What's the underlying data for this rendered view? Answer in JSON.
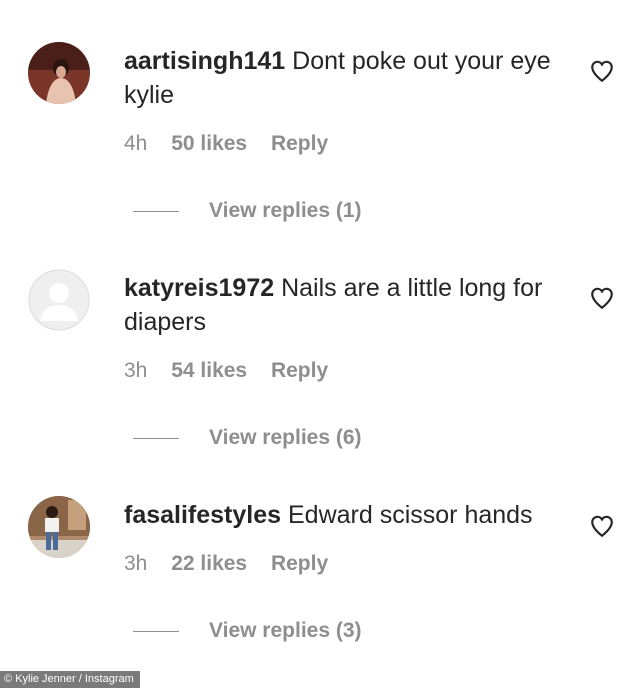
{
  "comments": [
    {
      "username": "aartisingh141",
      "text": "Dont poke out your eye kylie",
      "time": "4h",
      "likes": "50 likes",
      "reply_label": "Reply",
      "view_replies": "View replies (1)",
      "avatar_icon": "user-photo-avatar"
    },
    {
      "username": "katyreis1972",
      "text": "Nails are a little long for diapers",
      "time": "3h",
      "likes": "54 likes",
      "reply_label": "Reply",
      "view_replies": "View replies (6)",
      "avatar_icon": "default-user-avatar"
    },
    {
      "username": "fasalifestyles",
      "text": "Edward scissor hands",
      "time": "3h",
      "likes": "22 likes",
      "reply_label": "Reply",
      "view_replies": "View replies (3)",
      "avatar_icon": "user-photo-avatar"
    }
  ],
  "credit": "© Kylie Jenner / Instagram",
  "colors": {
    "text": "#262626",
    "muted": "#8e8e8e",
    "credit_bg": "#7a7a7a"
  }
}
